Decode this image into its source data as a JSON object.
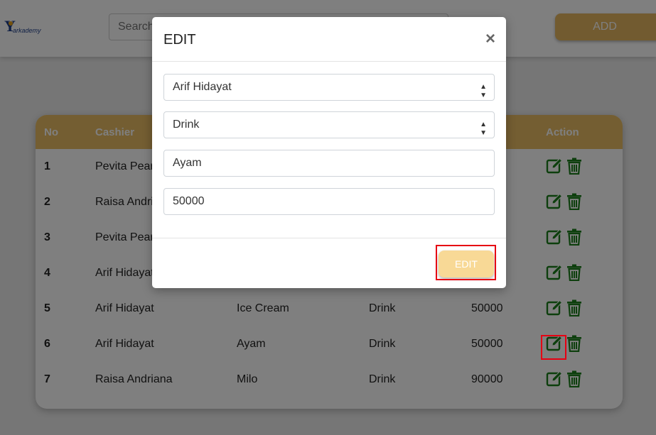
{
  "app": {
    "logo_text": "arkademy"
  },
  "header": {
    "search_placeholder": "Search",
    "add_label": "ADD"
  },
  "table": {
    "columns": {
      "no": "No",
      "cashier": "Cashier",
      "action": "Action"
    },
    "rows": [
      {
        "no": "1",
        "cashier": "Pevita Pearce",
        "product": "",
        "category": "",
        "price": ""
      },
      {
        "no": "2",
        "cashier": "Raisa Andriana",
        "product": "",
        "category": "",
        "price": ""
      },
      {
        "no": "3",
        "cashier": "Pevita Pearce",
        "product": "",
        "category": "",
        "price": ""
      },
      {
        "no": "4",
        "cashier": "Arif Hidayat",
        "product": "",
        "category": "",
        "price": ""
      },
      {
        "no": "5",
        "cashier": "Arif Hidayat",
        "product": "Ice Cream",
        "category": "Drink",
        "price": "50000"
      },
      {
        "no": "6",
        "cashier": "Arif Hidayat",
        "product": "Ayam",
        "category": "Drink",
        "price": "50000"
      },
      {
        "no": "7",
        "cashier": "Raisa Andriana",
        "product": "Milo",
        "category": "Drink",
        "price": "90000"
      }
    ]
  },
  "modal": {
    "title": "EDIT",
    "close_symbol": "×",
    "cashier_select": "Arif Hidayat",
    "category_select": "Drink",
    "name_input": "Ayam",
    "price_input": "50000",
    "submit_label": "EDIT"
  },
  "colors": {
    "accent": "#e8bd64",
    "icon_green": "#1a7f1a",
    "highlight": "#e60012"
  }
}
